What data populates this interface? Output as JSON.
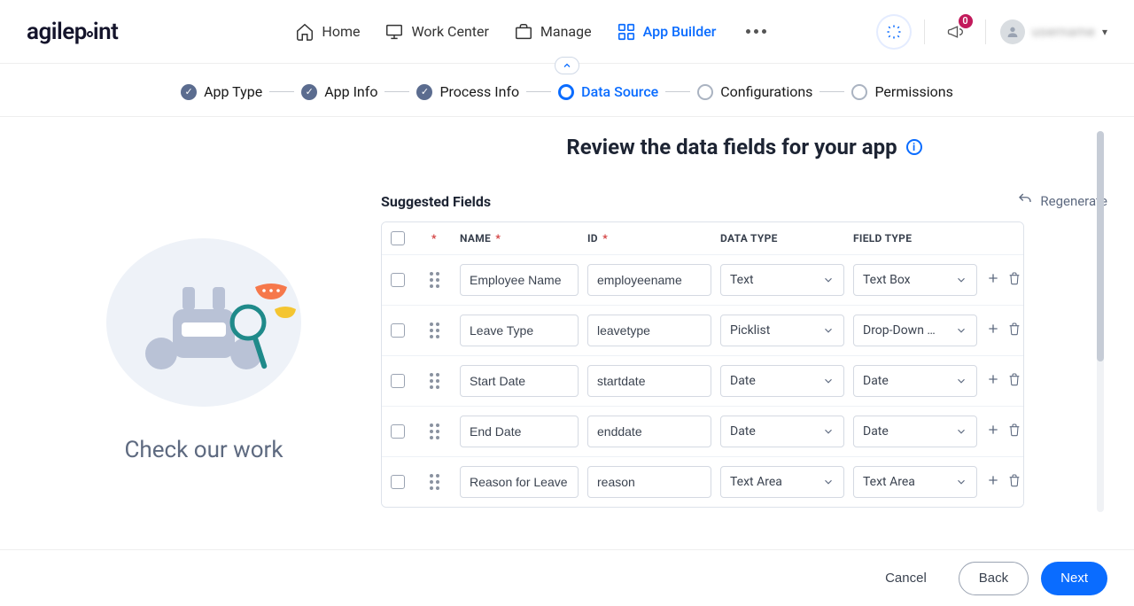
{
  "brand": {
    "name": "agilepoint"
  },
  "nav": {
    "items": [
      {
        "label": "Home",
        "icon": "home-icon"
      },
      {
        "label": "Work Center",
        "icon": "monitor-icon"
      },
      {
        "label": "Manage",
        "icon": "briefcase-icon"
      },
      {
        "label": "App Builder",
        "icon": "grid-icon",
        "active": true
      }
    ]
  },
  "notifications": {
    "count": "0"
  },
  "user": {
    "name": "username"
  },
  "steps": [
    {
      "label": "App Type",
      "state": "done"
    },
    {
      "label": "App Info",
      "state": "done"
    },
    {
      "label": "Process Info",
      "state": "done"
    },
    {
      "label": "Data Source",
      "state": "current"
    },
    {
      "label": "Configurations",
      "state": "pending"
    },
    {
      "label": "Permissions",
      "state": "pending"
    }
  ],
  "left": {
    "caption": "Check our work"
  },
  "page": {
    "title": "Review the data fields for your app",
    "suggested_title": "Suggested Fields",
    "regenerate": "Regenerate"
  },
  "columns": {
    "name": "NAME",
    "id": "ID",
    "datatype": "DATA TYPE",
    "fieldtype": "FIELD TYPE"
  },
  "rows": [
    {
      "name": "Employee Name",
      "id": "employeename",
      "datatype": "Text",
      "fieldtype": "Text Box",
      "has_gear": false
    },
    {
      "name": "Leave Type",
      "id": "leavetype",
      "datatype": "Picklist",
      "fieldtype": "Drop-Down …",
      "has_gear": true
    },
    {
      "name": "Start Date",
      "id": "startdate",
      "datatype": "Date",
      "fieldtype": "Date",
      "has_gear": false
    },
    {
      "name": "End Date",
      "id": "enddate",
      "datatype": "Date",
      "fieldtype": "Date",
      "has_gear": false
    },
    {
      "name": "Reason for Leave",
      "id": "reason",
      "datatype": "Text Area",
      "fieldtype": "Text Area",
      "has_gear": false
    }
  ],
  "footer": {
    "cancel": "Cancel",
    "back": "Back",
    "next": "Next"
  }
}
